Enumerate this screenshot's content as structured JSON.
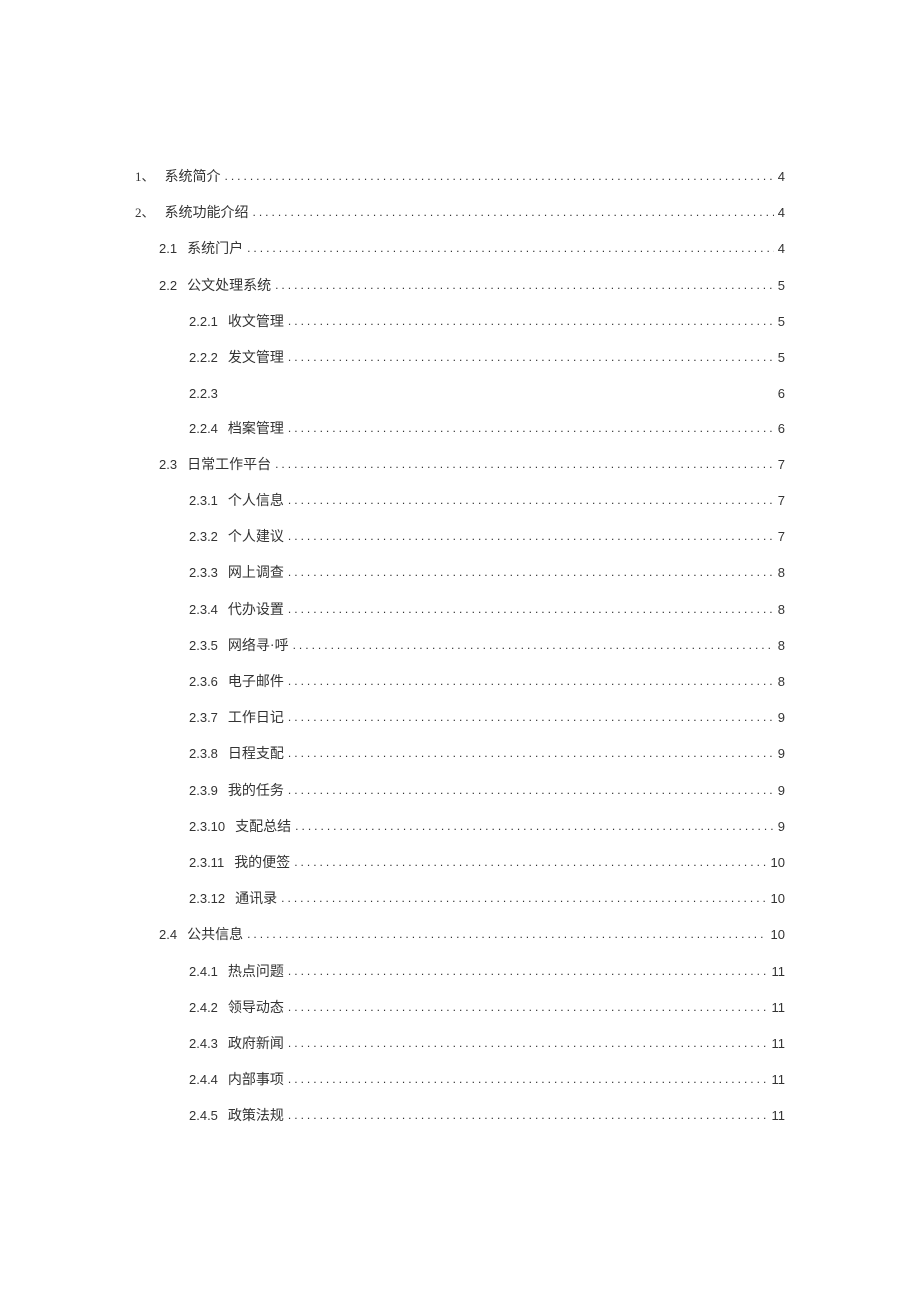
{
  "toc": [
    {
      "num": "1、",
      "title": "系统简介",
      "page": "4",
      "level": 0,
      "cn": true
    },
    {
      "num": "2、",
      "title": "系统功能介绍",
      "page": "4",
      "level": 0,
      "cn": true
    },
    {
      "num": "2.1",
      "title": "系统门户",
      "page": "4",
      "level": 1
    },
    {
      "num": "2.2",
      "title": "公文处理系统",
      "page": "5",
      "level": 1
    },
    {
      "num": "2.2.1",
      "title": "收文管理",
      "page": "5",
      "level": 2
    },
    {
      "num": "2.2.2",
      "title": "发文管理",
      "page": "5",
      "level": 2
    },
    {
      "num": "2.2.3",
      "title": "",
      "page": "6",
      "level": 2,
      "nodots": true
    },
    {
      "num": "2.2.4",
      "title": "档案管理",
      "page": "6",
      "level": 2
    },
    {
      "num": "2.3",
      "title": "日常工作平台",
      "page": "7",
      "level": 1
    },
    {
      "num": "2.3.1",
      "title": "个人信息",
      "page": "7",
      "level": 2
    },
    {
      "num": "2.3.2",
      "title": "个人建议",
      "page": "7",
      "level": 2
    },
    {
      "num": "2.3.3",
      "title": "网上调查",
      "page": "8",
      "level": 2
    },
    {
      "num": "2.3.4",
      "title": "代办设置",
      "page": "8",
      "level": 2
    },
    {
      "num": "2.3.5",
      "title": "网络寻·呼",
      "page": "8",
      "level": 2
    },
    {
      "num": "2.3.6",
      "title": "电子邮件",
      "page": "8",
      "level": 2
    },
    {
      "num": "2.3.7",
      "title": "工作日记",
      "page": "9",
      "level": 2
    },
    {
      "num": "2.3.8",
      "title": "日程支配",
      "page": "9",
      "level": 2
    },
    {
      "num": "2.3.9",
      "title": "我的任务",
      "page": "9",
      "level": 2
    },
    {
      "num": "2.3.10",
      "title": "支配总结",
      "page": "9",
      "level": 2
    },
    {
      "num": "2.3.11",
      "title": "我的便签",
      "page": "10",
      "level": 2
    },
    {
      "num": "2.3.12",
      "title": "通讯录",
      "page": "10",
      "level": 2
    },
    {
      "num": "2.4",
      "title": "公共信息",
      "page": "10",
      "level": 1
    },
    {
      "num": "2.4.1",
      "title": "热点问题",
      "page": "11",
      "level": 2
    },
    {
      "num": "2.4.2",
      "title": "领导动态",
      "page": "11",
      "level": 2
    },
    {
      "num": "2.4.3",
      "title": "政府新闻",
      "page": "11",
      "level": 2
    },
    {
      "num": "2.4.4",
      "title": "内部事项",
      "page": "11",
      "level": 2
    },
    {
      "num": "2.4.5",
      "title": "政策法规",
      "page": "11",
      "level": 2
    }
  ],
  "dots": "............................................................................................................................"
}
